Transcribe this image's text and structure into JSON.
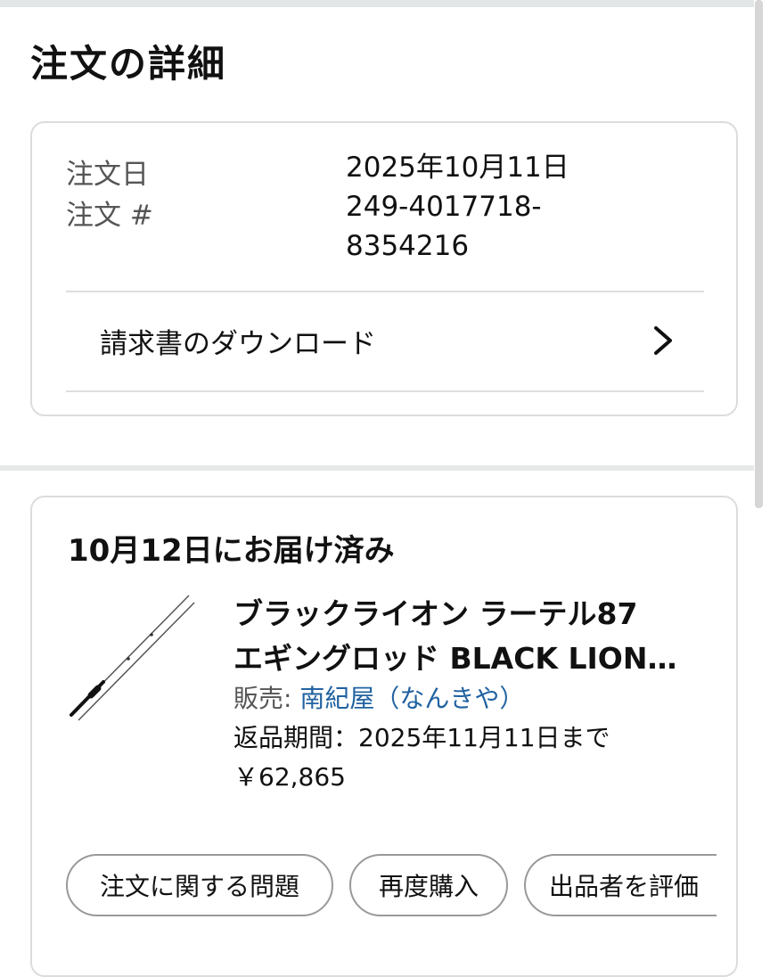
{
  "page": {
    "title": "注文の詳細"
  },
  "order_summary": {
    "date_label": "注文日",
    "date_value": "2025年10月11日",
    "number_label": "注文 #",
    "number_value_line1": "249-4017718-",
    "number_value_line2": "8354216",
    "invoice_label": "請求書のダウンロード",
    "invoice_icon": "chevron-right-icon"
  },
  "shipment": {
    "status": "10月12日にお届け済み",
    "product": {
      "image_icon": "fishing-rod-image",
      "title_line1": "ブラックライオン ラーテル87",
      "title_line2": "エギングロッド BLACK LION…",
      "seller_prefix": "販売: ",
      "seller_name": "南紀屋（なんきや）",
      "return_window": "返品期間：2025年11月11日まで",
      "price": "￥62,865"
    },
    "actions": {
      "problem": "注文に関する問題",
      "buy_again": "再度購入",
      "rate_seller": "出品者を評価"
    }
  },
  "colors": {
    "link": "#2162a1",
    "border": "#dcdcdc",
    "muted_text": "#555555"
  }
}
